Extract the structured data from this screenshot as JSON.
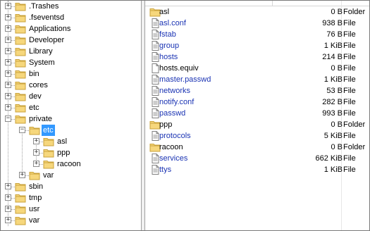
{
  "tree": {
    "items": [
      {
        "label": ".Trashes",
        "expander": "+"
      },
      {
        "label": ".fseventsd",
        "expander": "+"
      },
      {
        "label": "Applications",
        "expander": "+"
      },
      {
        "label": "Developer",
        "expander": "+"
      },
      {
        "label": "Library",
        "expander": "+"
      },
      {
        "label": "System",
        "expander": "+"
      },
      {
        "label": "bin",
        "expander": "+"
      },
      {
        "label": "cores",
        "expander": "+"
      },
      {
        "label": "dev",
        "expander": "+"
      },
      {
        "label": "etc",
        "expander": "+"
      },
      {
        "label": "private",
        "expander": "−"
      },
      {
        "label": "etc",
        "expander": "−",
        "selected": true
      },
      {
        "label": "asl",
        "expander": "+"
      },
      {
        "label": "ppp",
        "expander": "+"
      },
      {
        "label": "racoon",
        "expander": "+"
      },
      {
        "label": "var",
        "expander": "+"
      },
      {
        "label": "sbin",
        "expander": "+"
      },
      {
        "label": "tmp",
        "expander": "+"
      },
      {
        "label": "usr",
        "expander": "+"
      },
      {
        "label": "var",
        "expander": "+"
      }
    ]
  },
  "files": [
    {
      "name": "asl",
      "size": "0 B",
      "type": "Folder",
      "kind": "folder"
    },
    {
      "name": "asl.conf",
      "size": "938 B",
      "type": "File",
      "kind": "doc"
    },
    {
      "name": "fstab",
      "size": "76 B",
      "type": "File",
      "kind": "doc"
    },
    {
      "name": "group",
      "size": "1 KiB",
      "type": "File",
      "kind": "doc"
    },
    {
      "name": "hosts",
      "size": "214 B",
      "type": "File",
      "kind": "doc"
    },
    {
      "name": "hosts.equiv",
      "size": "0 B",
      "type": "File",
      "kind": "blank"
    },
    {
      "name": "master.passwd",
      "size": "1 KiB",
      "type": "File",
      "kind": "doc"
    },
    {
      "name": "networks",
      "size": "53 B",
      "type": "File",
      "kind": "doc"
    },
    {
      "name": "notify.conf",
      "size": "282 B",
      "type": "File",
      "kind": "doc"
    },
    {
      "name": "passwd",
      "size": "993 B",
      "type": "File",
      "kind": "doc"
    },
    {
      "name": "ppp",
      "size": "0 B",
      "type": "Folder",
      "kind": "folder"
    },
    {
      "name": "protocols",
      "size": "5 KiB",
      "type": "File",
      "kind": "doc"
    },
    {
      "name": "racoon",
      "size": "0 B",
      "type": "Folder",
      "kind": "folder"
    },
    {
      "name": "services",
      "size": "662 KiB",
      "type": "File",
      "kind": "doc"
    },
    {
      "name": "ttys",
      "size": "1 KiB",
      "type": "File",
      "kind": "doc"
    }
  ],
  "colors": {
    "folder": "#f6d77c",
    "selection": "#3399ff",
    "link_text": "#1a33b3"
  }
}
